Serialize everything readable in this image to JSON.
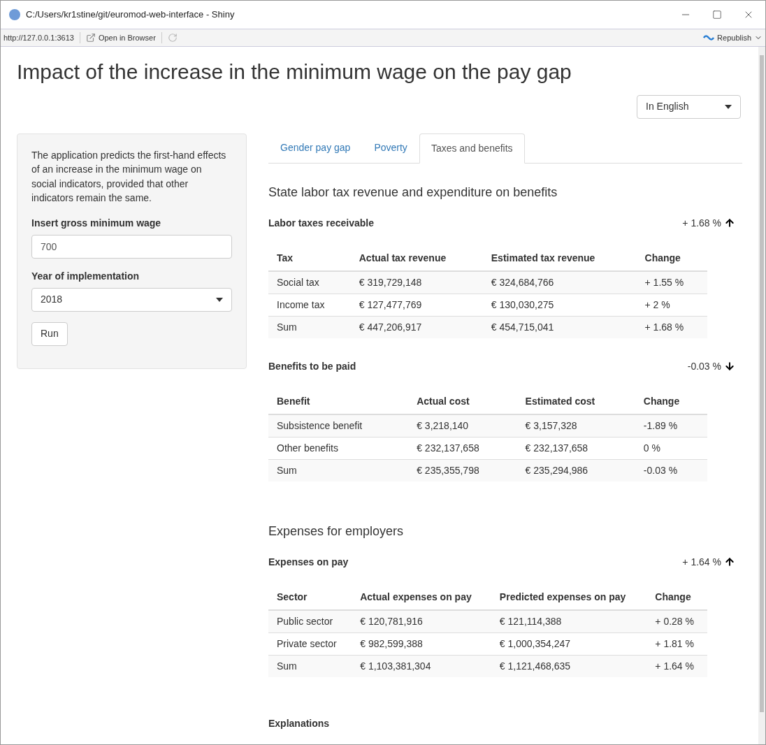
{
  "window": {
    "title": "C:/Users/kr1stine/git/euromod-web-interface - Shiny"
  },
  "toolbar": {
    "address": "http://127.0.0.1:3613",
    "open_in_browser": "Open in Browser",
    "republish": "Republish"
  },
  "page_title": "Impact of the increase in the minimum wage on the pay gap",
  "language_select": {
    "value": "In English"
  },
  "sidebar": {
    "description": "The application predicts the first-hand effects of an increase in the minimum wage on social indicators, provided that other indicators remain the same.",
    "wage_label": "Insert gross minimum wage",
    "wage_value": "700",
    "year_label": "Year of implementation",
    "year_value": "2018",
    "run_button": "Run"
  },
  "tabs": [
    {
      "label": "Gender pay gap",
      "selected": false
    },
    {
      "label": "Poverty",
      "selected": false
    },
    {
      "label": "Taxes and benefits",
      "selected": true
    }
  ],
  "sections": [
    {
      "heading": "State labor tax revenue and expenditure on benefits",
      "blocks": [
        {
          "title": "Labor taxes receivable",
          "change": "+ 1.68 %",
          "kind": "up",
          "columns": [
            "Tax",
            "Actual tax revenue",
            "Estimated tax revenue",
            "Change"
          ],
          "rows": [
            [
              "Social tax",
              "€ 319,729,148",
              "€ 324,684,766",
              "+ 1.55 %"
            ],
            [
              "Income tax",
              "€ 127,477,769",
              "€ 130,030,275",
              "+ 2 %"
            ],
            [
              "Sum",
              "€ 447,206,917",
              "€ 454,715,041",
              "+ 1.68 %"
            ]
          ]
        },
        {
          "title": "Benefits to be paid",
          "change": "-0.03 %",
          "kind": "down",
          "columns": [
            "Benefit",
            "Actual cost",
            "Estimated cost",
            "Change"
          ],
          "rows": [
            [
              "Subsistence benefit",
              "€ 3,218,140",
              "€ 3,157,328",
              "-1.89 %"
            ],
            [
              "Other benefits",
              "€ 232,137,658",
              "€ 232,137,658",
              "0 %"
            ],
            [
              "Sum",
              "€ 235,355,798",
              "€ 235,294,986",
              "-0.03 %"
            ]
          ]
        }
      ]
    },
    {
      "heading": "Expenses for employers",
      "blocks": [
        {
          "title": "Expenses on pay",
          "change": "+ 1.64 %",
          "kind": "up",
          "columns": [
            "Sector",
            "Actual expenses on pay",
            "Predicted expenses on pay",
            "Change"
          ],
          "rows": [
            [
              "Public sector",
              "€ 120,781,916",
              "€ 121,114,388",
              "+ 0.28 %"
            ],
            [
              "Private sector",
              "€ 982,599,388",
              "€ 1,000,354,247",
              "+ 1.81 %"
            ],
            [
              "Sum",
              "€ 1,103,381,304",
              "€ 1,121,468,635",
              "+ 1.64 %"
            ]
          ]
        }
      ]
    }
  ],
  "explanations_heading": "Explanations"
}
